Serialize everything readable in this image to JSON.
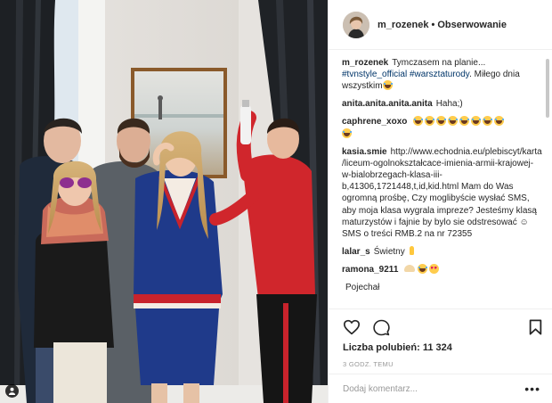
{
  "post": {
    "username": "m_rozenek",
    "separator": "•",
    "follow_label": "Obserwowanie"
  },
  "caption": {
    "username": "m_rozenek",
    "text_before": "Tymczasem na planie...",
    "hashtag1": "#tvnstyle_official",
    "hashtag2": "#warsztaturody",
    "text_after": ". Miłego dnia wszystkim"
  },
  "comments": [
    {
      "username": "anita.anita.anita.anita",
      "text": "Haha;)"
    },
    {
      "username": "caphrene_xoxo",
      "text": ""
    },
    {
      "username": "kasia.smie",
      "text": "http://www.echodnia.eu/plebiscyt/karta/liceum-ogolnokształcace-imienia-armii-krajowej-w-bialobrzegach-klasa-iii-b,41306,1721448,t,id,kid.html Mam do Was ogromną prośbę, Czy moglibyście wysłać SMS, aby moja klasa wygrala impreze? Jesteśmy klasą maturzystów i fajnie by bylo sie odstresować ☺ SMS o treści RMB.2 na nr 72355"
    },
    {
      "username": "lalar_s",
      "text": "Świetny"
    },
    {
      "username": "ramona_9211",
      "text": ""
    },
    {
      "username": "",
      "text": "Pojechał"
    }
  ],
  "icons": {
    "like": "heart-icon",
    "comment": "comment-icon",
    "save": "bookmark-icon",
    "more": "more-options-icon",
    "user_tag": "user-tag-icon"
  },
  "likes": {
    "label": "Liczba polubień:",
    "count": "11 324"
  },
  "timestamp": "3 GODZ. TEMU",
  "add_comment": {
    "placeholder": "Dodaj komentarz...",
    "more": "•••"
  },
  "colors": {
    "link": "#003569",
    "text": "#262626",
    "muted": "#999999",
    "border": "#efefef"
  }
}
